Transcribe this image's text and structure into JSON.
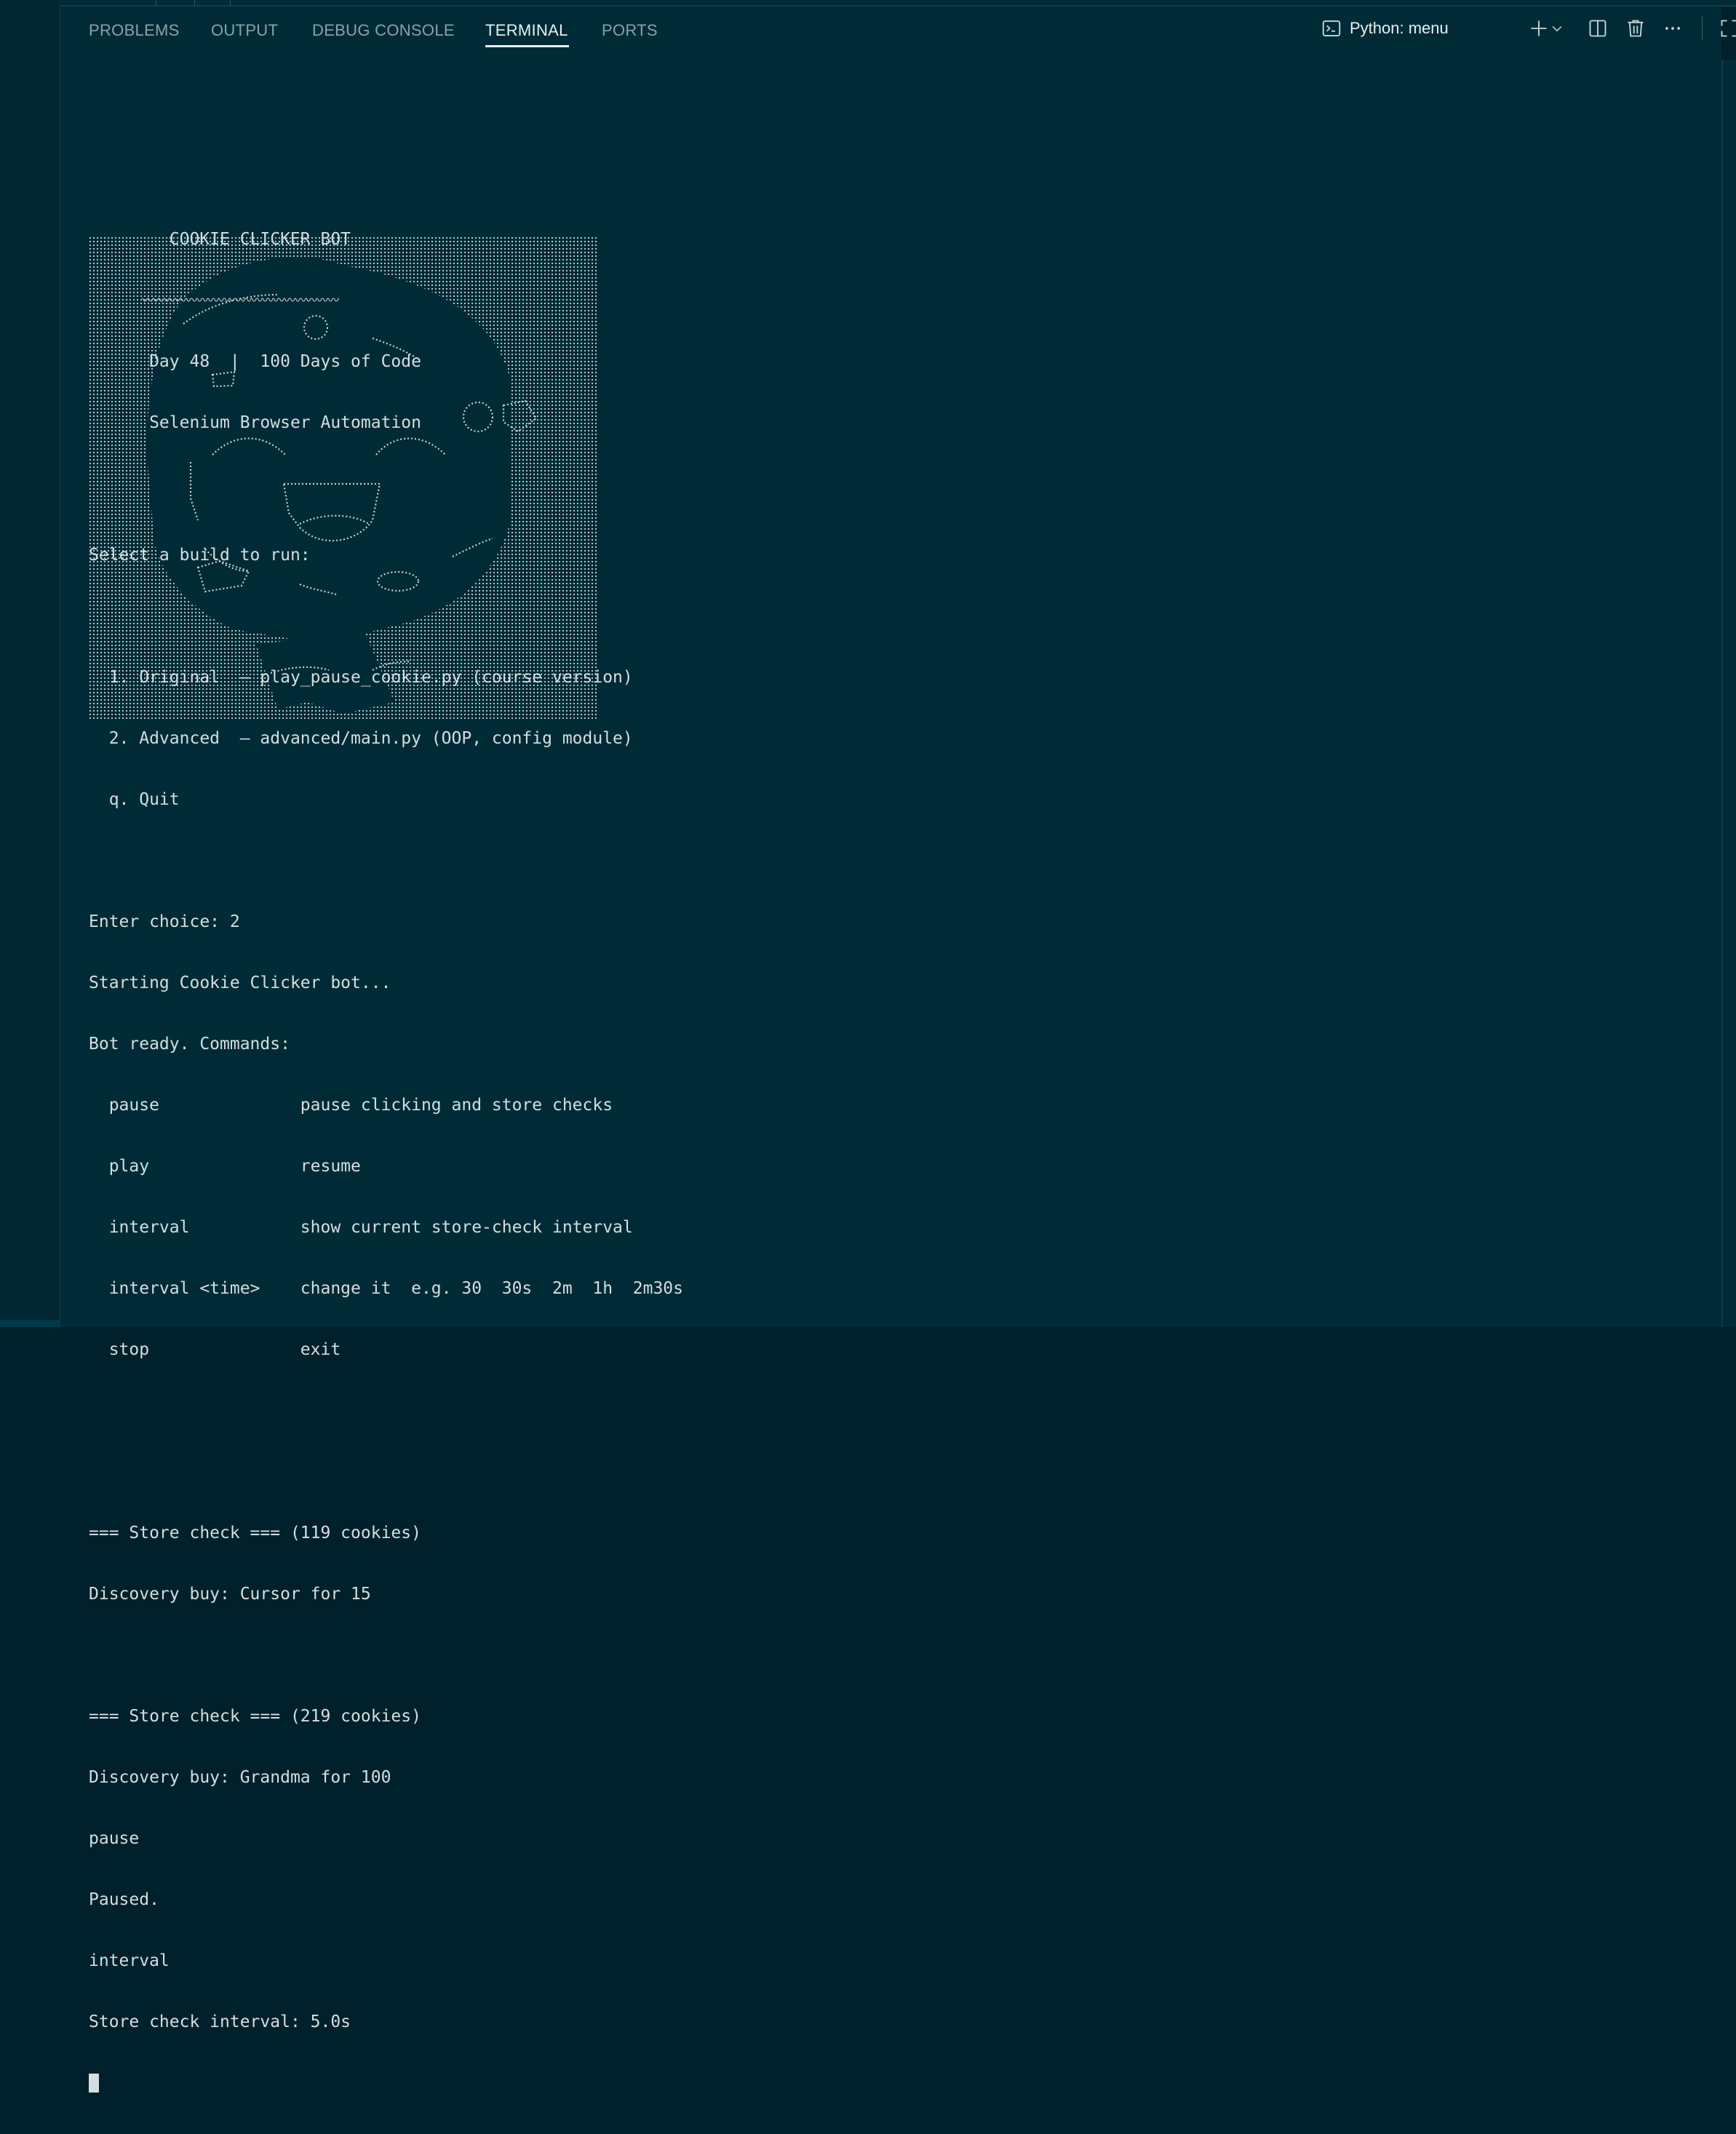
{
  "tabs": [
    {
      "label": "PROBLEMS"
    },
    {
      "label": "OUTPUT"
    },
    {
      "label": "DEBUG CONSOLE"
    },
    {
      "label": "TERMINAL"
    },
    {
      "label": "PORTS"
    }
  ],
  "active_tab": "TERMINAL",
  "terminal_selector": {
    "label": "Python: menu",
    "icon": "terminal-icon"
  },
  "toolbar_icons": [
    "plus-icon",
    "chevron-down-icon",
    "split-icon",
    "trash-icon",
    "ellipsis-icon",
    "maximize-icon",
    "close-icon"
  ],
  "colors": {
    "background": "#002b36",
    "text": "#d5dee0",
    "tab_inactive": "#8aa1a8",
    "tab_active": "#e6f0f2"
  },
  "banner": {
    "title": "COOKIE CLICKER BOT",
    "wave": "〰〰〰〰〰〰〰〰〰〰〰〰〰〰〰〰〰〰",
    "subtitle1": "Day 48  |  100 Days of Code",
    "subtitle2": "Selenium Browser Automation"
  },
  "menu": {
    "prompt": "Select a build to run:",
    "options": [
      "  1. Original  — play_pause_cookie.py (course version)",
      "  2. Advanced  — advanced/main.py (OOP, config module)",
      "  q. Quit"
    ]
  },
  "session": [
    "Enter choice: 2",
    "Starting Cookie Clicker bot...",
    "Bot ready. Commands:",
    "  pause              pause clicking and store checks",
    "  play               resume",
    "  interval           show current store-check interval",
    "  interval <time>    change it  e.g. 30  30s  2m  1h  2m30s",
    "  stop               exit"
  ],
  "log": [
    "=== Store check === (119 cookies)",
    "Discovery buy: Cursor for 15",
    "",
    "=== Store check === (219 cookies)",
    "Discovery buy: Grandma for 100",
    "pause",
    "Paused.",
    "interval",
    "Store check interval: 5.0s"
  ]
}
